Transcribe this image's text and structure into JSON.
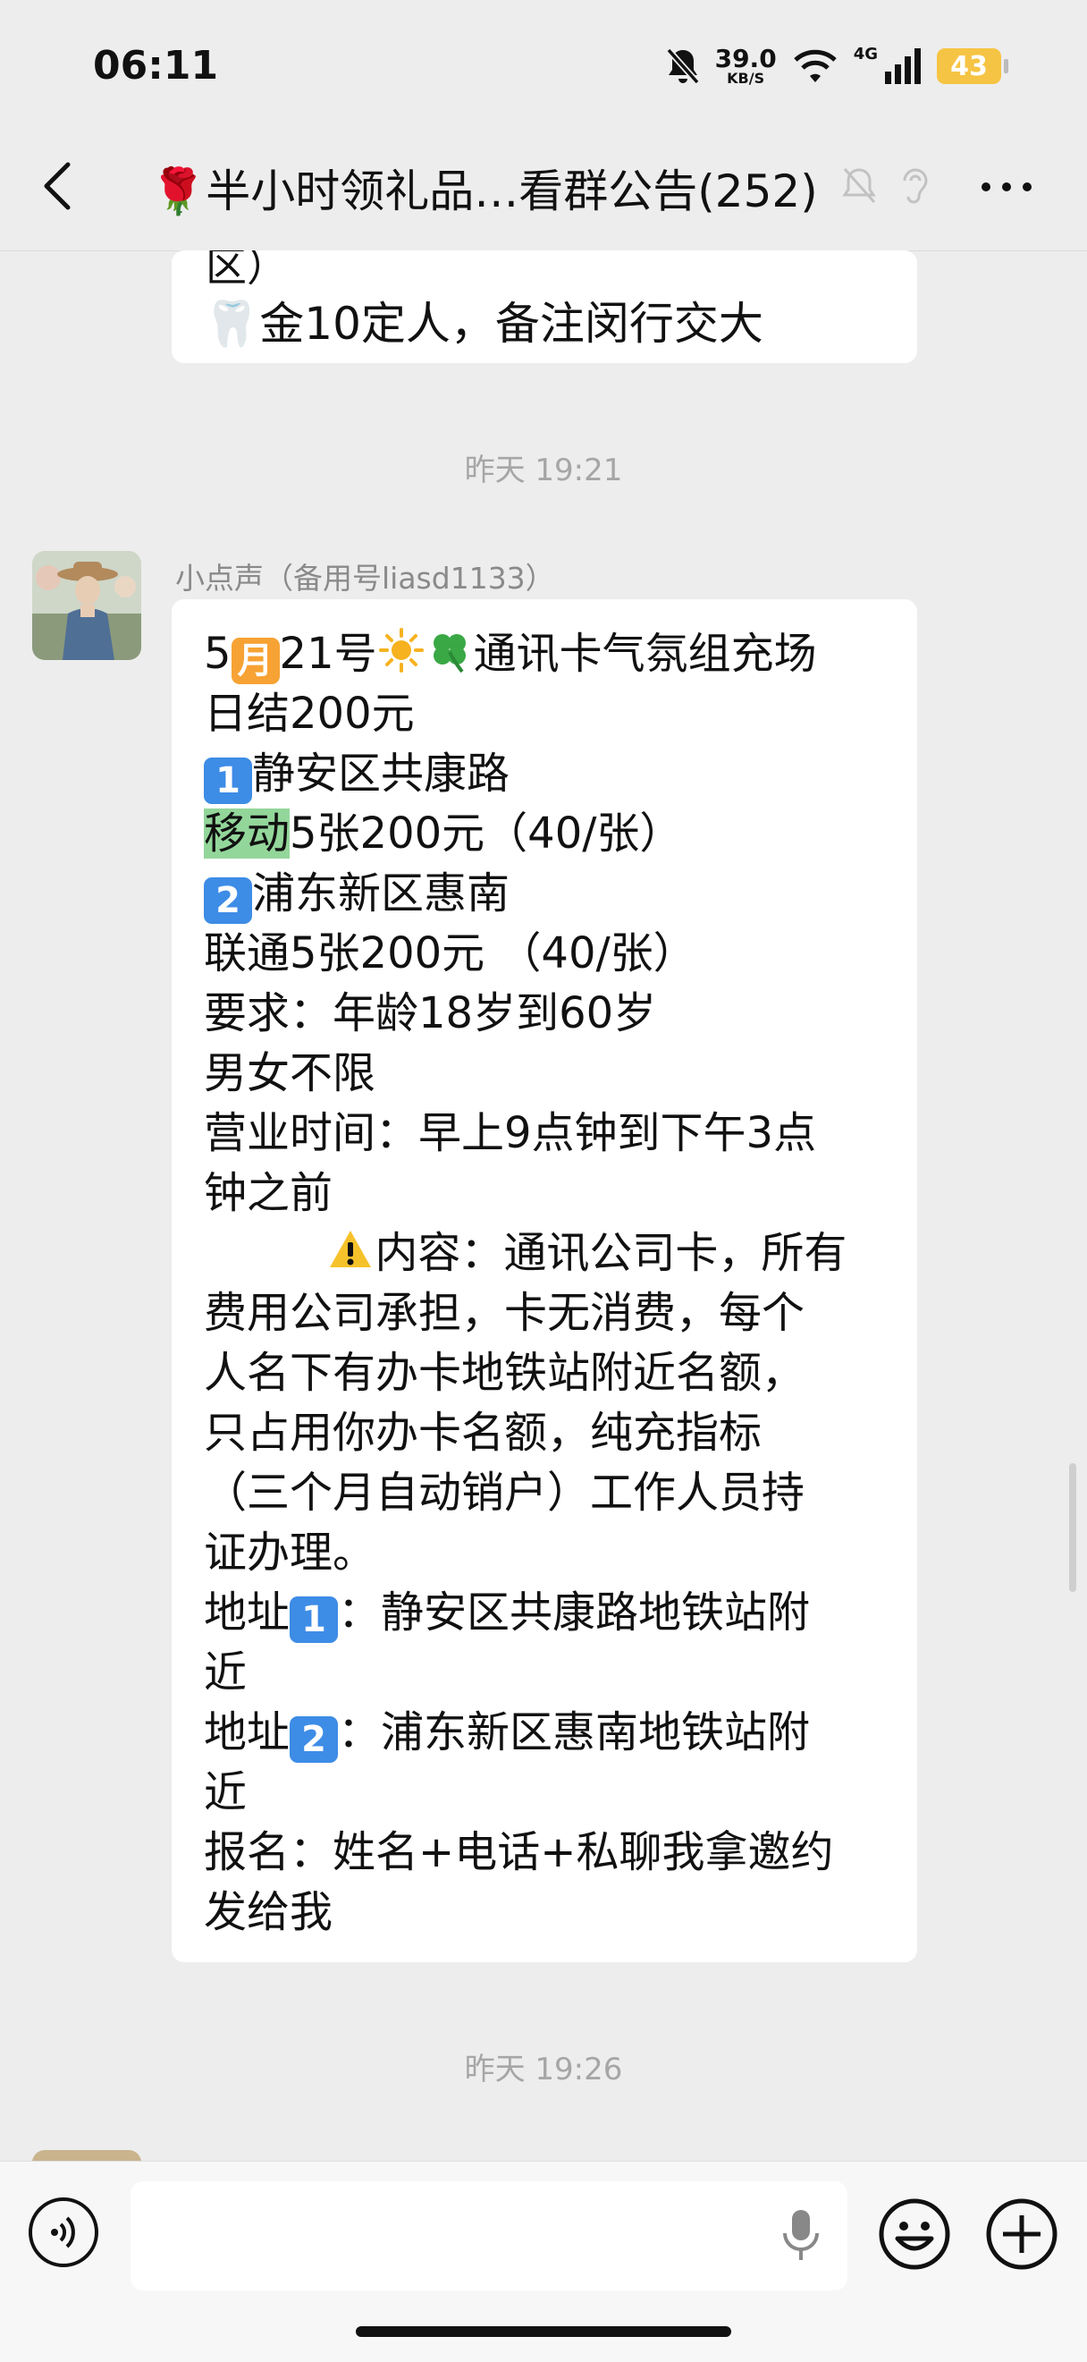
{
  "status_bar": {
    "time": "06:11",
    "net_speed": "39.0",
    "net_speed_unit": "KB/S",
    "network": "4G",
    "battery": "43"
  },
  "header": {
    "title": "🌹半小时领礼品…看群公告(252)"
  },
  "messages": {
    "prev_cut_text": "区）",
    "prev_line": "🦷金10定人，备注闵行交大",
    "timestamp_1": "昨天 19:21",
    "sender": "小点声（备用号liasd1133）",
    "lines": {
      "l1_a": "5",
      "l1_badge": "月",
      "l1_b": "21号",
      "l1_c": "通讯卡气氛组充场",
      "l2": "日结200元",
      "badge_1": "1",
      "l3": "静安区共康路",
      "l4_hl": "移动",
      "l4_rest": "5张200元（40/张）",
      "badge_2": "2",
      "l5": "浦东新区惠南",
      "l6": "联通5张200元 （40/张）",
      "l7": "要求：年龄18岁到60岁",
      "l8": "男女不限",
      "l9": "营业时间：早上9点钟到下午3点",
      "l10": "钟之前",
      "l11": "内容：通讯公司卡，所有",
      "l12": "费用公司承担，卡无消费，每个",
      "l13": "人名下有办卡地铁站附近名额，",
      "l14": "只占用你办卡名额，纯充指标",
      "l15": "（三个月自动销户）工作人员持",
      "l16": "证办理。",
      "addr_label": "地址",
      "l17_rest": "：静安区共康路地铁站附",
      "l18": "近",
      "l19_rest": "：浦东新区惠南地铁站附",
      "l20": "近",
      "l21": "报名：姓名+电话+私聊我拿邀约",
      "l22": "发给我"
    },
    "timestamp_2": "昨天 19:26"
  },
  "colors": {
    "background": "#ededed",
    "bubble": "#ffffff",
    "highlight": "#93d69a",
    "keycap_blue": "#3d8ce6",
    "battery": "#f6c444"
  }
}
